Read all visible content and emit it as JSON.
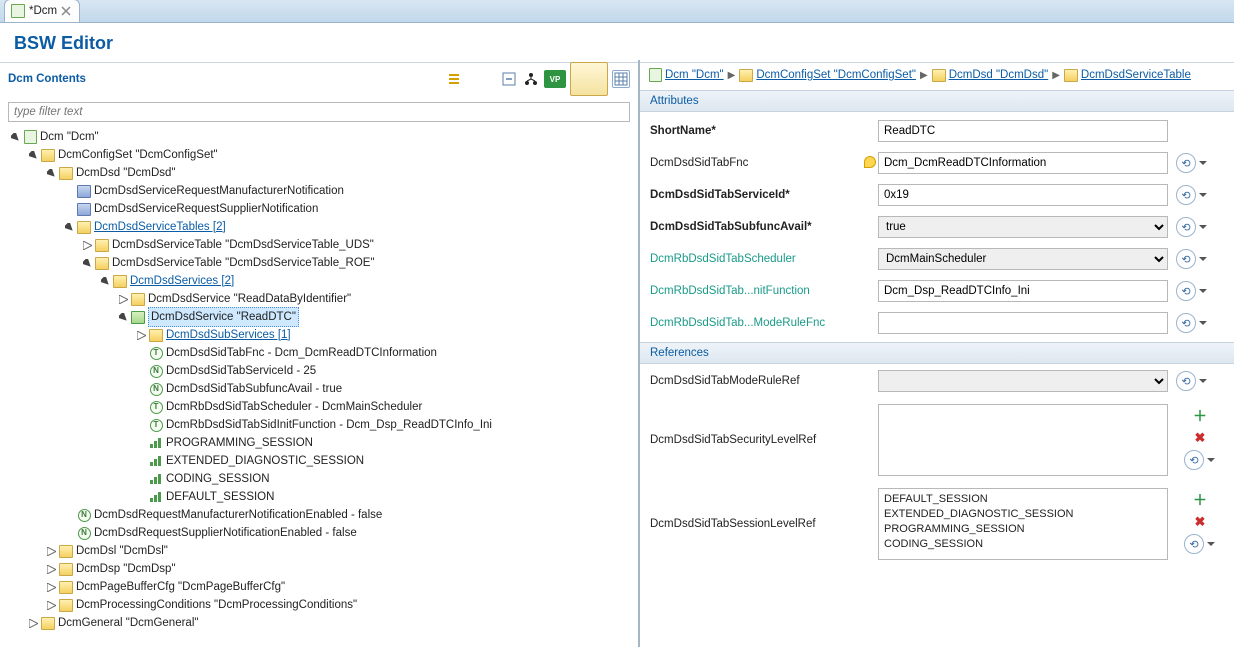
{
  "tab": {
    "title": "*Dcm"
  },
  "editor_title": "BSW Editor",
  "left_header": "Dcm Contents",
  "filter_placeholder": "type filter text",
  "tree": {
    "dcm": "Dcm \"Dcm\"",
    "cfgset": "DcmConfigSet \"DcmConfigSet\"",
    "dsd": "DcmDsd \"DcmDsd\"",
    "mfr_notif": "DcmDsdServiceRequestManufacturerNotification",
    "sup_notif": "DcmDsdServiceRequestSupplierNotification",
    "svc_tables": "DcmDsdServiceTables [2]",
    "svc_table_uds": "DcmDsdServiceTable \"DcmDsdServiceTable_UDS\"",
    "svc_table_roe": "DcmDsdServiceTable \"DcmDsdServiceTable_ROE\"",
    "svcs": "DcmDsdServices [2]",
    "svc_rdbi": "DcmDsdService \"ReadDataByIdentifier\"",
    "svc_rdtc": "DcmDsdService \"ReadDTC\"",
    "subservices": "DcmDsdSubServices [1]",
    "p_fnc": "DcmDsdSidTabFnc - Dcm_DcmReadDTCInformation",
    "p_svcid": "DcmDsdSidTabServiceId - 25",
    "p_sfavail": "DcmDsdSidTabSubfuncAvail - true",
    "p_sched": "DcmRbDsdSidTabScheduler - DcmMainScheduler",
    "p_init": "DcmRbDsdSidTabSidInitFunction - Dcm_Dsp_ReadDTCInfo_Ini",
    "sess_prog": "PROGRAMMING_SESSION",
    "sess_extdiag": "EXTENDED_DIAGNOSTIC_SESSION",
    "sess_coding": "CODING_SESSION",
    "sess_default": "DEFAULT_SESSION",
    "mfr_enabled": "DcmDsdRequestManufacturerNotificationEnabled - false",
    "sup_enabled": "DcmDsdRequestSupplierNotificationEnabled - false",
    "dsl": "DcmDsl \"DcmDsl\"",
    "dsp": "DcmDsp \"DcmDsp\"",
    "pagebuf": "DcmPageBufferCfg \"DcmPageBufferCfg\"",
    "proccond": "DcmProcessingConditions \"DcmProcessingConditions\"",
    "general": "DcmGeneral \"DcmGeneral\""
  },
  "breadcrumb": {
    "b1": "Dcm \"Dcm\"",
    "b2": "DcmConfigSet \"DcmConfigSet\"",
    "b3": "DcmDsd \"DcmDsd\"",
    "b4": "DcmDsdServiceTable"
  },
  "attributes": {
    "title": "Attributes",
    "shortName": {
      "label": "ShortName*",
      "value": "ReadDTC"
    },
    "sidTabFnc": {
      "label": "DcmDsdSidTabFnc",
      "value": "Dcm_DcmReadDTCInformation"
    },
    "serviceId": {
      "label": "DcmDsdSidTabServiceId*",
      "value": "0x19"
    },
    "subfuncAvail": {
      "label": "DcmDsdSidTabSubfuncAvail*",
      "value": "true"
    },
    "scheduler": {
      "label": "DcmRbDsdSidTabScheduler",
      "value": "DcmMainScheduler"
    },
    "initFunction": {
      "label": "DcmRbDsdSidTab...nitFunction",
      "value": "Dcm_Dsp_ReadDTCInfo_Ini"
    },
    "modeRuleFnc": {
      "label": "DcmRbDsdSidTab...ModeRuleFnc",
      "value": ""
    }
  },
  "references": {
    "title": "References",
    "modeRuleRef": {
      "label": "DcmDsdSidTabModeRuleRef",
      "value": ""
    },
    "securityLevelRef": {
      "label": "DcmDsdSidTabSecurityLevelRef"
    },
    "sessionLevelRef": {
      "label": "DcmDsdSidTabSessionLevelRef",
      "items": [
        "DEFAULT_SESSION",
        "EXTENDED_DIAGNOSTIC_SESSION",
        "PROGRAMMING_SESSION",
        "CODING_SESSION"
      ]
    }
  }
}
